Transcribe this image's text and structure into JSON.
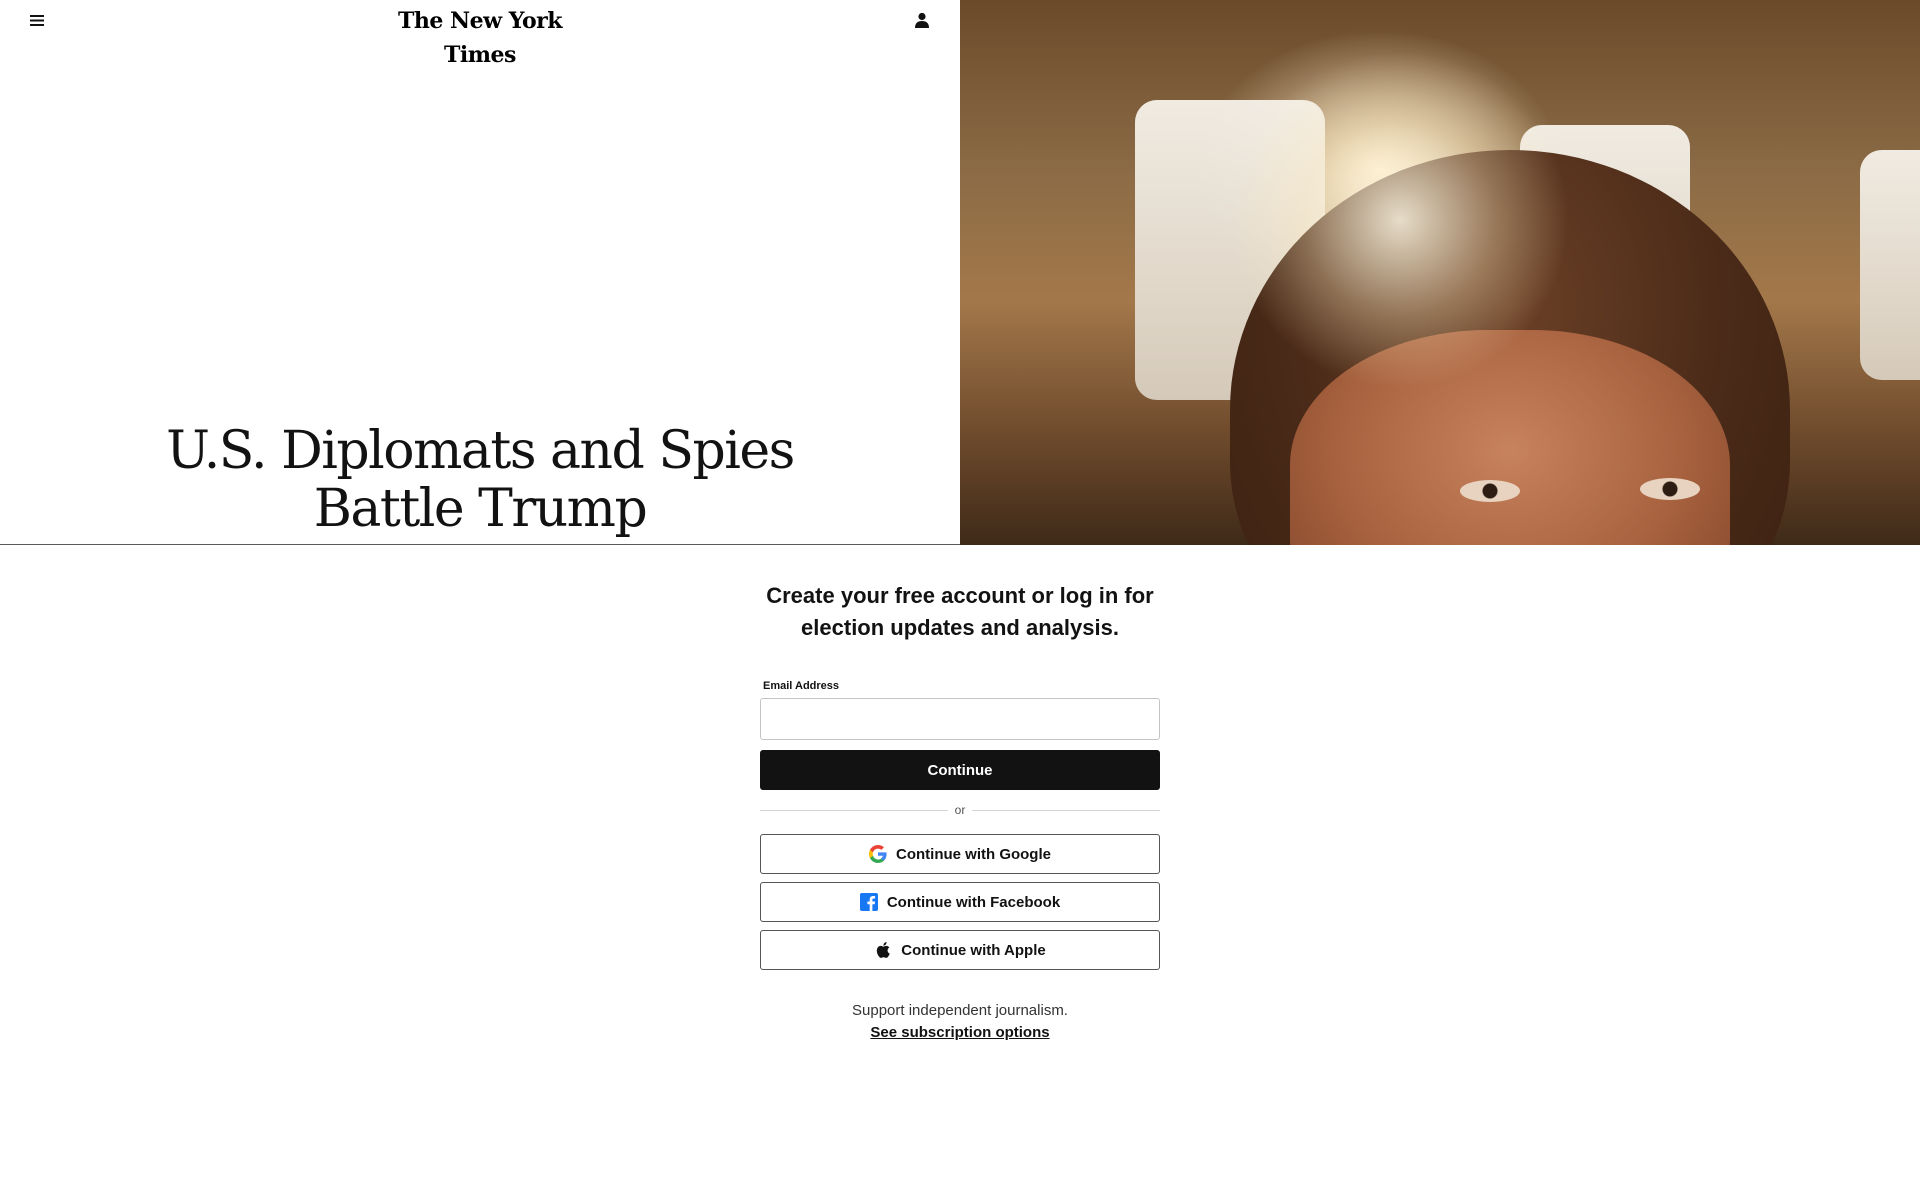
{
  "header": {
    "logo_text": "The New York Times",
    "menu_icon": "hamburger-menu-icon",
    "account_icon": "user-account-icon"
  },
  "article": {
    "headline": "U.S. Diplomats and Spies Battle Trump"
  },
  "auth": {
    "title": "Create your free account or log in for election updates and analysis.",
    "email_label": "Email Address",
    "email_value": "",
    "email_placeholder": "",
    "continue_label": "Continue",
    "divider_text": "or",
    "google_label": "Continue with Google",
    "facebook_label": "Continue with Facebook",
    "apple_label": "Continue with Apple",
    "support_text": "Support independent journalism.",
    "subscription_link": "See subscription options"
  },
  "colors": {
    "primary_button": "#121212",
    "facebook_blue": "#1877F2",
    "google_blue": "#4285F4",
    "google_red": "#EA4335",
    "google_yellow": "#FBBC05",
    "google_green": "#34A853"
  }
}
